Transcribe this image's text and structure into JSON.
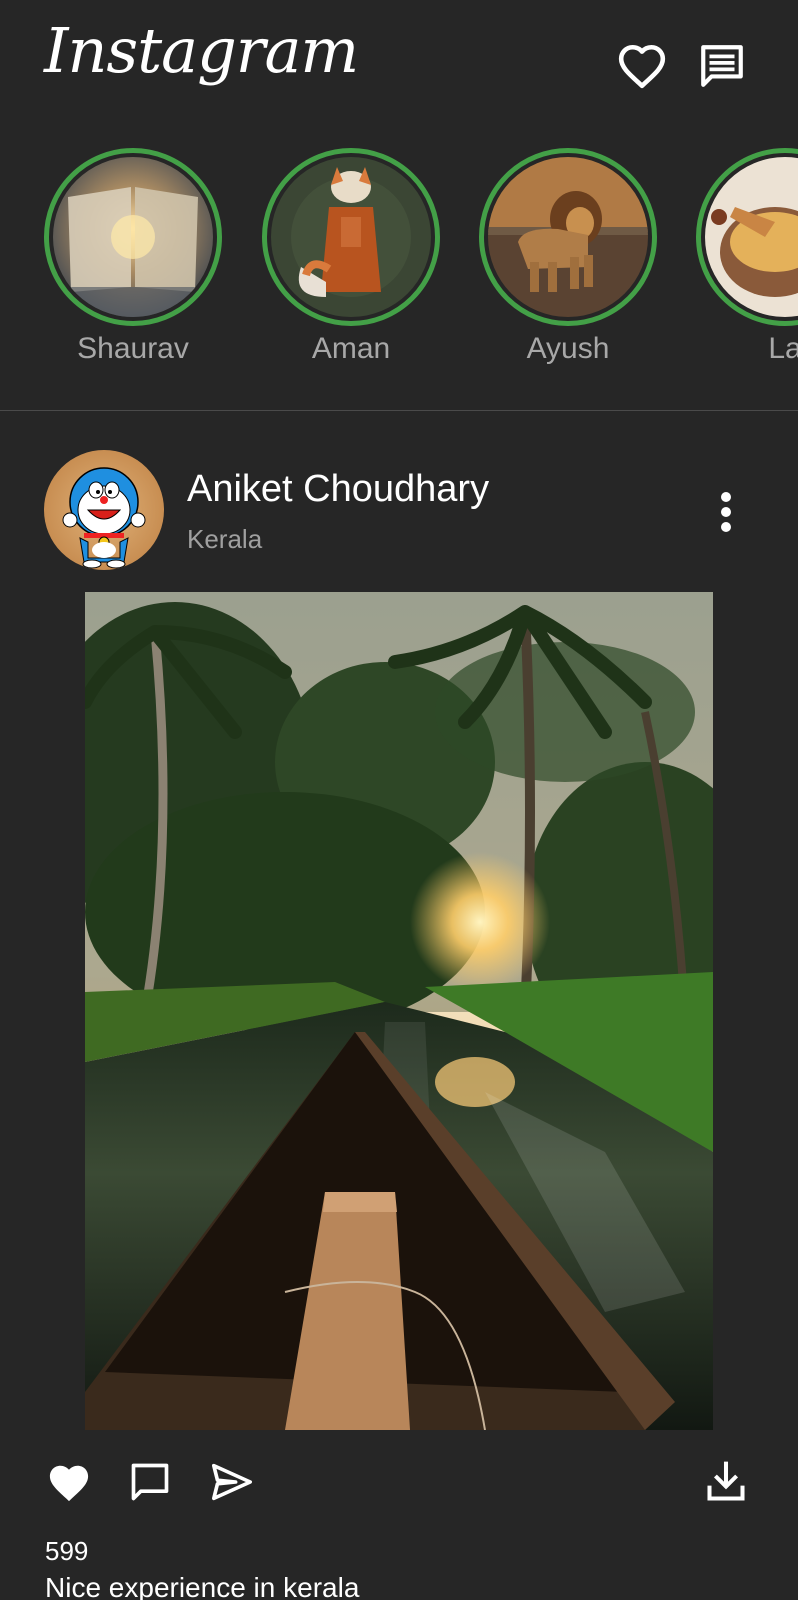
{
  "app": {
    "title": "Instagram"
  },
  "header": {
    "notifications_icon": "heart-outline-icon",
    "messages_icon": "message-icon"
  },
  "stories": [
    {
      "name": "Shaurav"
    },
    {
      "name": "Aman"
    },
    {
      "name": "Ayush"
    },
    {
      "name": "La"
    }
  ],
  "post": {
    "username": "Aniket Choudhary",
    "location": "Kerala",
    "likes": "599",
    "caption": "Nice experience in kerala",
    "actions": [
      "heart-filled-icon",
      "comment-icon",
      "send-icon",
      "download-icon"
    ]
  },
  "colors": {
    "background": "#262626",
    "story_ring": "#43a047",
    "text": "#ffffff",
    "secondary_text": "#a8a8a8"
  }
}
